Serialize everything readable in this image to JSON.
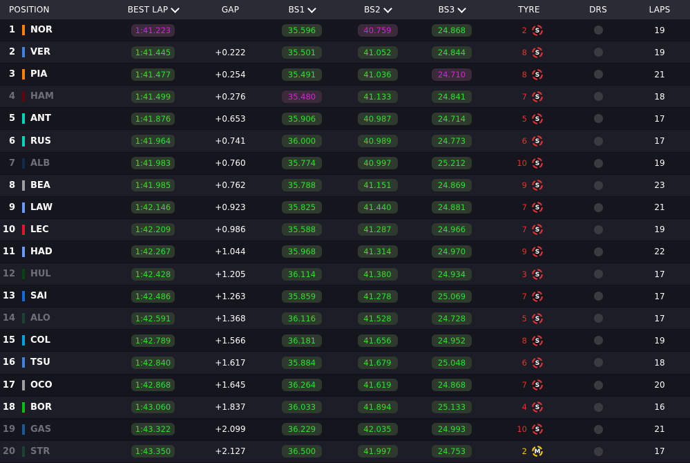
{
  "header": {
    "position": "POSITION",
    "best_lap": "BEST LAP",
    "gap": "GAP",
    "bs1": "BS1",
    "bs2": "BS2",
    "bs3": "BS3",
    "tyre": "TYRE",
    "drs": "DRS",
    "laps": "LAPS"
  },
  "colors": {
    "green": "#2fe02f",
    "purple": "#d623d6",
    "soft_tyre": "#e8302f",
    "medium_tyre": "#f5c800"
  },
  "rows": [
    {
      "pos": "1",
      "drv": "NOR",
      "team": "#ff8000",
      "dim": false,
      "best": "1:41.223",
      "best_p": true,
      "gap": "",
      "bs1": "35.596",
      "bs1_p": false,
      "bs2": "40.759",
      "bs2_p": true,
      "bs3": "24.868",
      "bs3_p": false,
      "age": "2",
      "tyre": "S",
      "laps": "19"
    },
    {
      "pos": "2",
      "drv": "VER",
      "team": "#4781d7",
      "dim": false,
      "best": "1:41.445",
      "best_p": false,
      "gap": "+0.222",
      "bs1": "35.501",
      "bs1_p": false,
      "bs2": "41.052",
      "bs2_p": false,
      "bs3": "24.844",
      "bs3_p": false,
      "age": "8",
      "tyre": "S",
      "laps": "19"
    },
    {
      "pos": "3",
      "drv": "PIA",
      "team": "#ff8000",
      "dim": false,
      "best": "1:41.477",
      "best_p": false,
      "gap": "+0.254",
      "bs1": "35.491",
      "bs1_p": false,
      "bs2": "41.036",
      "bs2_p": false,
      "bs3": "24.710",
      "bs3_p": true,
      "age": "8",
      "tyre": "S",
      "laps": "21"
    },
    {
      "pos": "4",
      "drv": "HAM",
      "team": "#710006",
      "dim": true,
      "best": "1:41.499",
      "best_p": false,
      "gap": "+0.276",
      "bs1": "35.480",
      "bs1_p": true,
      "bs2": "41.133",
      "bs2_p": false,
      "bs3": "24.841",
      "bs3_p": false,
      "age": "7",
      "tyre": "S",
      "laps": "18"
    },
    {
      "pos": "5",
      "drv": "ANT",
      "team": "#00d7b6",
      "dim": false,
      "best": "1:41.876",
      "best_p": false,
      "gap": "+0.653",
      "bs1": "35.906",
      "bs1_p": false,
      "bs2": "40.987",
      "bs2_p": false,
      "bs3": "24.714",
      "bs3_p": false,
      "age": "5",
      "tyre": "S",
      "laps": "17"
    },
    {
      "pos": "6",
      "drv": "RUS",
      "team": "#00d7b6",
      "dim": false,
      "best": "1:41.964",
      "best_p": false,
      "gap": "+0.741",
      "bs1": "36.000",
      "bs1_p": false,
      "bs2": "40.989",
      "bs2_p": false,
      "bs3": "24.773",
      "bs3_p": false,
      "age": "6",
      "tyre": "S",
      "laps": "17"
    },
    {
      "pos": "7",
      "drv": "ALB",
      "team": "#14305a",
      "dim": true,
      "best": "1:41.983",
      "best_p": false,
      "gap": "+0.760",
      "bs1": "35.774",
      "bs1_p": false,
      "bs2": "40.997",
      "bs2_p": false,
      "bs3": "25.212",
      "bs3_p": false,
      "age": "10",
      "tyre": "S",
      "laps": "19"
    },
    {
      "pos": "8",
      "drv": "BEA",
      "team": "#9c9fa2",
      "dim": false,
      "best": "1:41.985",
      "best_p": false,
      "gap": "+0.762",
      "bs1": "35.788",
      "bs1_p": false,
      "bs2": "41.151",
      "bs2_p": false,
      "bs3": "24.869",
      "bs3_p": false,
      "age": "9",
      "tyre": "S",
      "laps": "23"
    },
    {
      "pos": "9",
      "drv": "LAW",
      "team": "#6c98ff",
      "dim": false,
      "best": "1:42.146",
      "best_p": false,
      "gap": "+0.923",
      "bs1": "35.825",
      "bs1_p": false,
      "bs2": "41.440",
      "bs2_p": false,
      "bs3": "24.881",
      "bs3_p": false,
      "age": "7",
      "tyre": "S",
      "laps": "21"
    },
    {
      "pos": "10",
      "drv": "LEC",
      "team": "#ed1131",
      "dim": false,
      "best": "1:42.209",
      "best_p": false,
      "gap": "+0.986",
      "bs1": "35.588",
      "bs1_p": false,
      "bs2": "41.287",
      "bs2_p": false,
      "bs3": "24.966",
      "bs3_p": false,
      "age": "7",
      "tyre": "S",
      "laps": "19"
    },
    {
      "pos": "11",
      "drv": "HAD",
      "team": "#6c98ff",
      "dim": false,
      "best": "1:42.267",
      "best_p": false,
      "gap": "+1.044",
      "bs1": "35.968",
      "bs1_p": false,
      "bs2": "41.314",
      "bs2_p": false,
      "bs3": "24.970",
      "bs3_p": false,
      "age": "9",
      "tyre": "S",
      "laps": "22"
    },
    {
      "pos": "12",
      "drv": "HUL",
      "team": "#01520d",
      "dim": true,
      "best": "1:42.428",
      "best_p": false,
      "gap": "+1.205",
      "bs1": "36.114",
      "bs1_p": false,
      "bs2": "41.380",
      "bs2_p": false,
      "bs3": "24.934",
      "bs3_p": false,
      "age": "3",
      "tyre": "S",
      "laps": "17"
    },
    {
      "pos": "13",
      "drv": "SAI",
      "team": "#1868db",
      "dim": false,
      "best": "1:42.486",
      "best_p": false,
      "gap": "+1.263",
      "bs1": "35.859",
      "bs1_p": false,
      "bs2": "41.278",
      "bs2_p": false,
      "bs3": "25.069",
      "bs3_p": false,
      "age": "7",
      "tyre": "S",
      "laps": "17"
    },
    {
      "pos": "14",
      "drv": "ALO",
      "team": "#1e4d3b",
      "dim": true,
      "best": "1:42.591",
      "best_p": false,
      "gap": "+1.368",
      "bs1": "36.116",
      "bs1_p": false,
      "bs2": "41.528",
      "bs2_p": false,
      "bs3": "24.728",
      "bs3_p": false,
      "age": "5",
      "tyre": "S",
      "laps": "17"
    },
    {
      "pos": "15",
      "drv": "COL",
      "team": "#00a1e8",
      "dim": false,
      "best": "1:42.789",
      "best_p": false,
      "gap": "+1.566",
      "bs1": "36.181",
      "bs1_p": false,
      "bs2": "41.656",
      "bs2_p": false,
      "bs3": "24.952",
      "bs3_p": false,
      "age": "8",
      "tyre": "S",
      "laps": "19"
    },
    {
      "pos": "16",
      "drv": "TSU",
      "team": "#4781d7",
      "dim": false,
      "best": "1:42.840",
      "best_p": false,
      "gap": "+1.617",
      "bs1": "35.884",
      "bs1_p": false,
      "bs2": "41.679",
      "bs2_p": false,
      "bs3": "25.048",
      "bs3_p": false,
      "age": "6",
      "tyre": "S",
      "laps": "18"
    },
    {
      "pos": "17",
      "drv": "OCO",
      "team": "#9c9fa2",
      "dim": false,
      "best": "1:42.868",
      "best_p": false,
      "gap": "+1.645",
      "bs1": "36.264",
      "bs1_p": false,
      "bs2": "41.619",
      "bs2_p": false,
      "bs3": "24.868",
      "bs3_p": false,
      "age": "7",
      "tyre": "S",
      "laps": "20"
    },
    {
      "pos": "18",
      "drv": "BOR",
      "team": "#01c00e",
      "dim": false,
      "best": "1:43.060",
      "best_p": false,
      "gap": "+1.837",
      "bs1": "36.033",
      "bs1_p": false,
      "bs2": "41.894",
      "bs2_p": false,
      "bs3": "25.133",
      "bs3_p": false,
      "age": "4",
      "tyre": "S",
      "laps": "16"
    },
    {
      "pos": "19",
      "drv": "GAS",
      "team": "#1f6fb8",
      "dim": true,
      "best": "1:43.322",
      "best_p": false,
      "gap": "+2.099",
      "bs1": "36.229",
      "bs1_p": false,
      "bs2": "42.035",
      "bs2_p": false,
      "bs3": "24.993",
      "bs3_p": false,
      "age": "10",
      "tyre": "S",
      "laps": "21"
    },
    {
      "pos": "20",
      "drv": "STR",
      "team": "#1e4d3b",
      "dim": true,
      "best": "1:43.350",
      "best_p": false,
      "gap": "+2.127",
      "bs1": "36.500",
      "bs1_p": false,
      "bs2": "41.997",
      "bs2_p": false,
      "bs3": "24.753",
      "bs3_p": false,
      "age": "2",
      "tyre": "M",
      "laps": "17"
    }
  ]
}
